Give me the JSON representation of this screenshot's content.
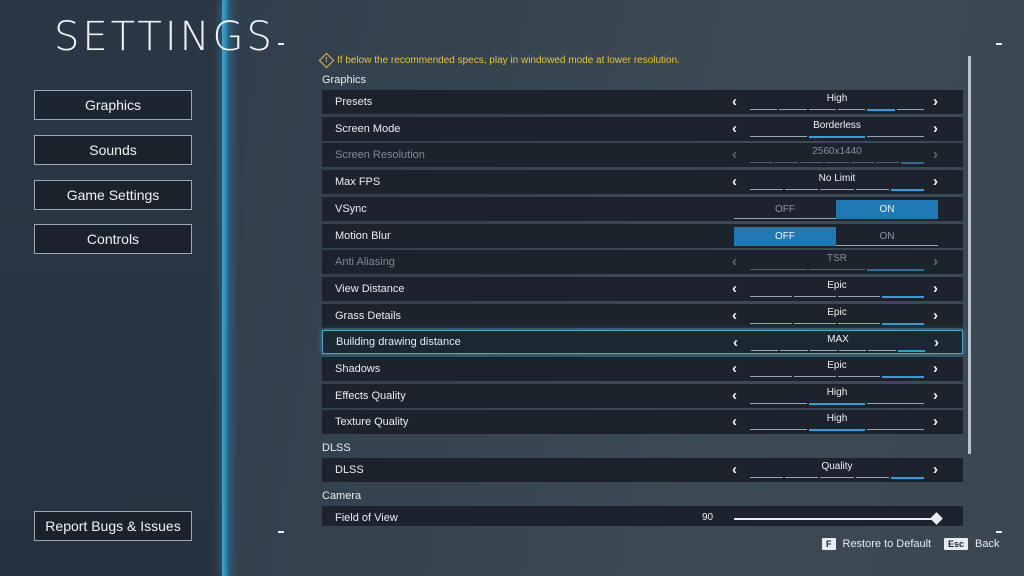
{
  "title": "SETTINGS",
  "menu": {
    "graphics": "Graphics",
    "sounds": "Sounds",
    "game_settings": "Game Settings",
    "controls": "Controls",
    "report": "Report Bugs & Issues"
  },
  "warning": "If below the recommended specs, play in windowed mode at lower resolution.",
  "sections": {
    "graphics": "Graphics",
    "dlss": "DLSS",
    "camera": "Camera"
  },
  "rows": {
    "presets": {
      "label": "Presets",
      "value": "High"
    },
    "screen_mode": {
      "label": "Screen Mode",
      "value": "Borderless"
    },
    "screen_resolution": {
      "label": "Screen Resolution",
      "value": "2560x1440"
    },
    "max_fps": {
      "label": "Max FPS",
      "value": "No Limit"
    },
    "vsync": {
      "label": "VSync",
      "off": "OFF",
      "on": "ON"
    },
    "motion_blur": {
      "label": "Motion Blur",
      "off": "OFF",
      "on": "ON"
    },
    "anti_aliasing": {
      "label": "Anti Aliasing",
      "value": "TSR"
    },
    "view_distance": {
      "label": "View Distance",
      "value": "Epic"
    },
    "grass_details": {
      "label": "Grass Details",
      "value": "Epic"
    },
    "building_distance": {
      "label": "Building drawing distance",
      "value": "MAX"
    },
    "shadows": {
      "label": "Shadows",
      "value": "Epic"
    },
    "effects_quality": {
      "label": "Effects Quality",
      "value": "High"
    },
    "texture_quality": {
      "label": "Texture Quality",
      "value": "High"
    },
    "dlss": {
      "label": "DLSS",
      "value": "Quality"
    },
    "field_of_view": {
      "label": "Field of View",
      "value": "90"
    }
  },
  "footer": {
    "restore_key": "F",
    "restore_label": "Restore to Default",
    "back_key": "Esc",
    "back_label": "Back"
  },
  "colors": {
    "accent": "#1e79b4",
    "warning": "#e7c23b",
    "highlight": "#4aa4c6"
  }
}
